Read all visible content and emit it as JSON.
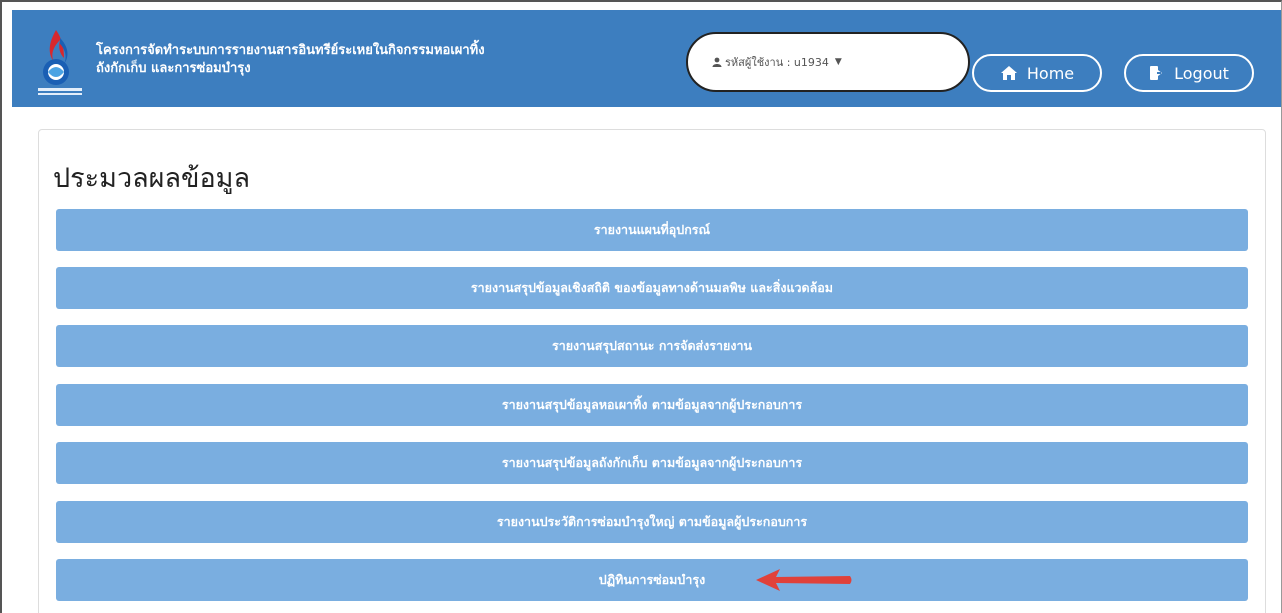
{
  "header": {
    "brand_line1": "โครงการจัดทำระบบการรายงานสารอินทรีย์ระเหยในกิจกรรมหอเผาทิ้ง",
    "brand_line2": "ถังกักเก็บ และการซ่อมบำรุง",
    "logo_icon": "organization-logo-icon",
    "user_label": "รหัสผู้ใช้งาน : u1934",
    "home_label": "Home",
    "logout_label": "Logout",
    "accent": "#3d7ebf"
  },
  "main": {
    "title": "ประมวลผลข้อมูล",
    "buttons": [
      "รายงานแผนที่อุปกรณ์",
      "รายงานสรุปข้อมูลเชิงสถิติ ของข้อมูลทางด้านมลพิษ และสิ่งแวดล้อม",
      "รายงานสรุปสถานะ การจัดส่งรายงาน",
      "รายงานสรุปข้อมูลหอเผาทิ้ง ตามข้อมูลจากผู้ประกอบการ",
      "รายงานสรุปข้อมูลถังกักเก็บ ตามข้อมูลจากผู้ประกอบการ",
      "รายงานประวัติการซ่อมบำรุงใหญ่ ตามข้อมูลผู้ประกอบการ",
      "ปฏิทินการซ่อมบำรุง"
    ],
    "button_color": "#7aaee0",
    "annotation_arrow_color": "#e0413a"
  }
}
